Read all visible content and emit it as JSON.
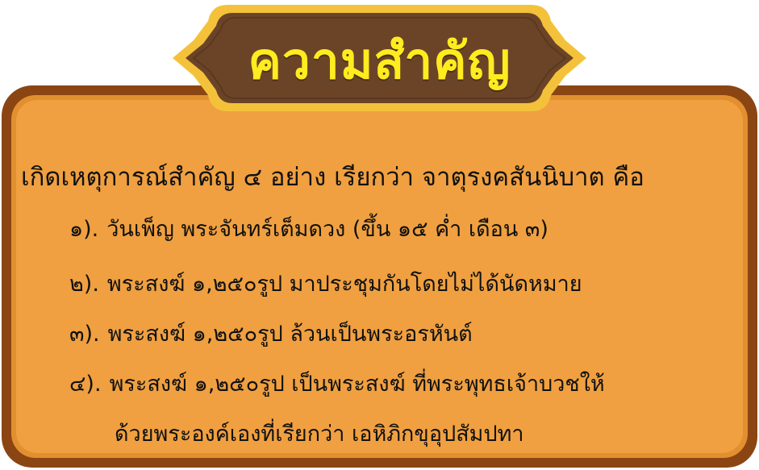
{
  "title": "ความสำคัญ",
  "intro": "เกิดเหตุการณ์สำคัญ ๔ อย่าง เรียกว่า จาตุรงคสันนิบาต คือ",
  "items": [
    {
      "number": "๑).",
      "text": "วันเพ็ญ พระจันทร์เต็มดวง (ขึ้น ๑๕ ค่ำ เดือน ๓)"
    },
    {
      "number": "๒).",
      "text": "พระสงฆ์ ๑,๒๕๐รูป มาประชุมกันโดยไม่ได้นัดหมาย"
    },
    {
      "number": "๓).",
      "text": "พระสงฆ์ ๑,๒๕๐รูป ล้วนเป็นพระอรหันต์"
    },
    {
      "number": "๔).",
      "text": "พระสงฆ์ ๑,๒๕๐รูป เป็นพระสงฆ์ ที่พระพุทธเจ้าบวชให้",
      "continuation": "ด้วยพระองค์เองที่เรียกว่า เอหิภิกขุอุปสัมปทา"
    }
  ],
  "colors": {
    "outer_border": "#8b4513",
    "panel_fill": "#f0a040",
    "panel_edge": "#e89838",
    "banner_fill": "#6b4428",
    "banner_outline": "#f4c23a",
    "title_text": "#ffec1f"
  }
}
